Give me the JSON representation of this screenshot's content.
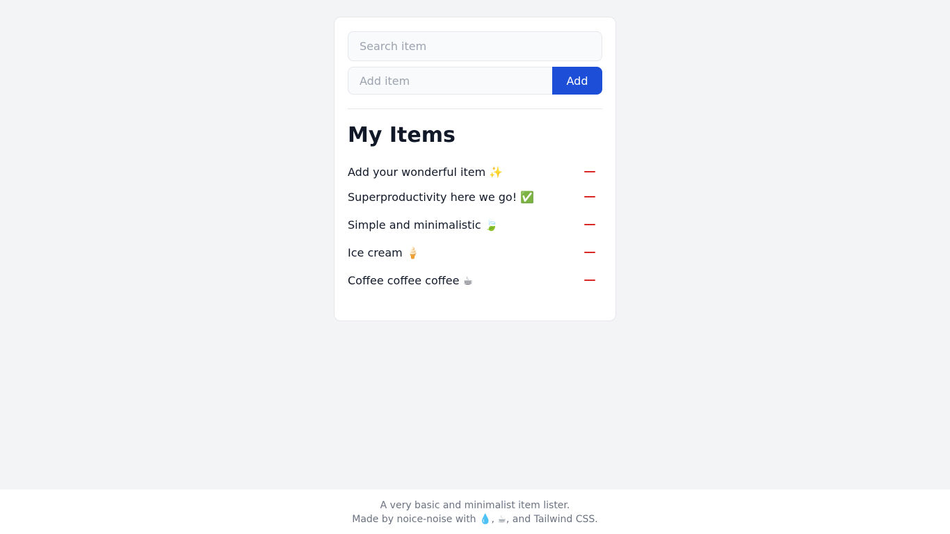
{
  "search": {
    "placeholder": "Search item"
  },
  "add": {
    "placeholder": "Add item",
    "button_label": "Add"
  },
  "title": "My Items",
  "items": [
    {
      "label": "Add your wonderful item ✨"
    },
    {
      "label": "Superproductivity here we go! ✅"
    },
    {
      "label": "Simple and minimalistic 🍃"
    },
    {
      "label": "Ice cream 🍦"
    },
    {
      "label": "Coffee coffee coffee ☕"
    }
  ],
  "footer": {
    "line1": "A very basic and minimalist item lister.",
    "line2": "Made by noice-noise with 💧, ☕, and Tailwind CSS."
  },
  "colors": {
    "accent": "#1d4ed8",
    "remove": "#dc2626",
    "background": "#f3f4f6"
  },
  "icons": {
    "remove": "minus-icon"
  }
}
